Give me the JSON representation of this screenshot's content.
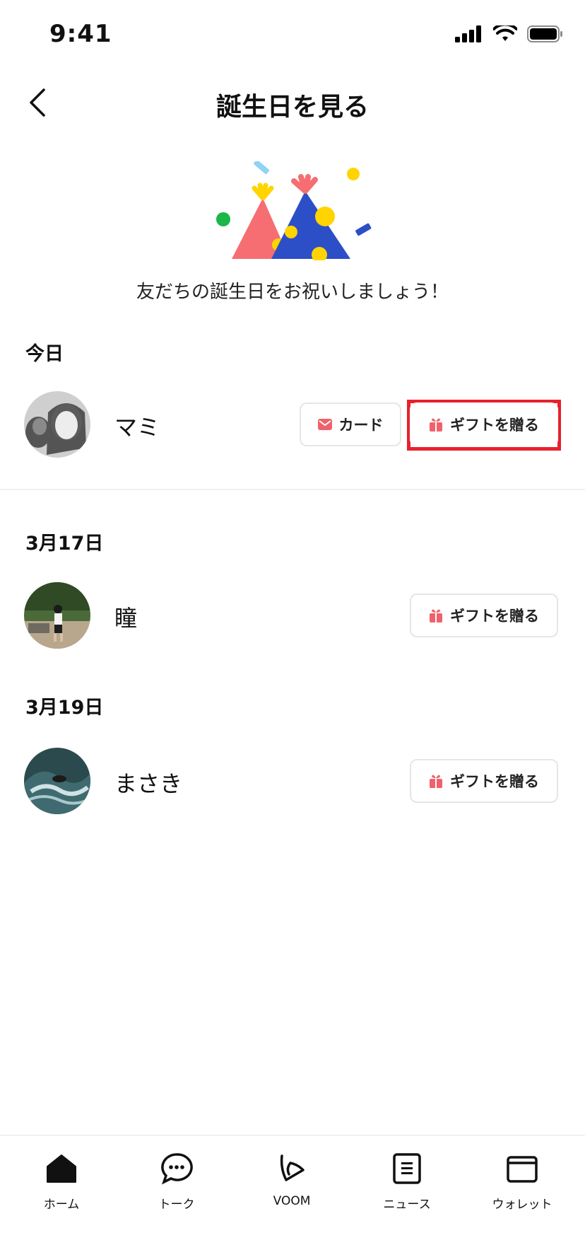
{
  "status": {
    "time": "9:41"
  },
  "header": {
    "title": "誕生日を見る"
  },
  "hero": {
    "message": "友だちの誕生日をお祝いしましょう！"
  },
  "sections": [
    {
      "heading": "今日",
      "friends": [
        {
          "name": "マミ",
          "card_label": "カード",
          "gift_label": "ギフトを贈る"
        }
      ]
    },
    {
      "heading": "3月17日",
      "friends": [
        {
          "name": "瞳",
          "gift_label": "ギフトを贈る"
        }
      ]
    },
    {
      "heading": "3月19日",
      "friends": [
        {
          "name": "まさき",
          "gift_label": "ギフトを贈る"
        }
      ]
    }
  ],
  "tabs": [
    {
      "label": "ホーム",
      "icon": "home-icon"
    },
    {
      "label": "トーク",
      "icon": "chat-icon"
    },
    {
      "label": "VOOM",
      "icon": "voom-icon"
    },
    {
      "label": "ニュース",
      "icon": "news-icon"
    },
    {
      "label": "ウォレット",
      "icon": "wallet-icon"
    }
  ],
  "colors": {
    "accent": "#f0616b",
    "highlight": "#e8212c"
  }
}
